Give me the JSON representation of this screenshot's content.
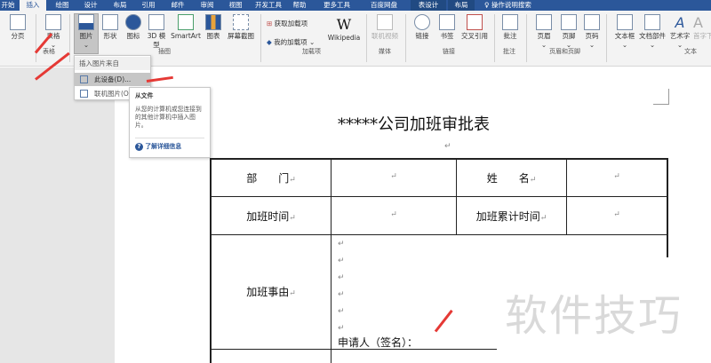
{
  "tabs": [
    "开始",
    "插入",
    "绘图",
    "设计",
    "布局",
    "引用",
    "邮件",
    "审阅",
    "视图",
    "开发工具",
    "帮助",
    "更多工具",
    "百度网盘",
    "表设计",
    "布局"
  ],
  "tell_me": "操作说明搜索",
  "ribbon": {
    "buttons": [
      "分页",
      "表格",
      "图片",
      "形状",
      "图标",
      "3D 模型",
      "SmartArt",
      "图表",
      "屏幕截图",
      "获取加载项",
      "我的加载项",
      "Wikipedia",
      "联机视频",
      "链接",
      "书签",
      "交叉引用",
      "批注",
      "页眉",
      "页脚",
      "页码",
      "文本框",
      "文档部件",
      "艺术字",
      "首字下沉"
    ],
    "groups": [
      "表格",
      "插图",
      "加载项",
      "媒体",
      "链接",
      "批注",
      "页眉和页脚",
      "文本"
    ]
  },
  "menu": {
    "header": "插入图片来自",
    "items": [
      "此设备(D)...",
      "联机图片(O)..."
    ]
  },
  "tooltip": {
    "title": "从文件",
    "body": "从您的计算机或您连接到的其他计算机中插入图片。",
    "link": "了解详细信息"
  },
  "document": {
    "title": "*****公司加班审批表",
    "rows": [
      [
        "部　　门",
        "",
        "姓　　名",
        ""
      ],
      [
        "加班时间",
        "",
        "加班累计时间",
        ""
      ]
    ],
    "reason_label": "加班事由",
    "signature": "申请人（签名）："
  },
  "watermark": "软件技巧",
  "colors": {
    "accent": "#2b579a",
    "arrow": "#e53935"
  }
}
